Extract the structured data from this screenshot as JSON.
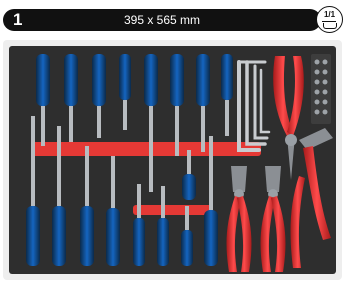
{
  "header": {
    "drawer_number": "1",
    "dimensions": "395 x 565 mm",
    "badge_label": "1/1"
  },
  "colors": {
    "bar": "#111111",
    "tray_foam": "#2e2e2e",
    "accent_blue": "#1565c0",
    "accent_red": "#e53935"
  },
  "photo": {
    "content": "tool-tray-foam-insert",
    "icon": "tray-icon"
  }
}
